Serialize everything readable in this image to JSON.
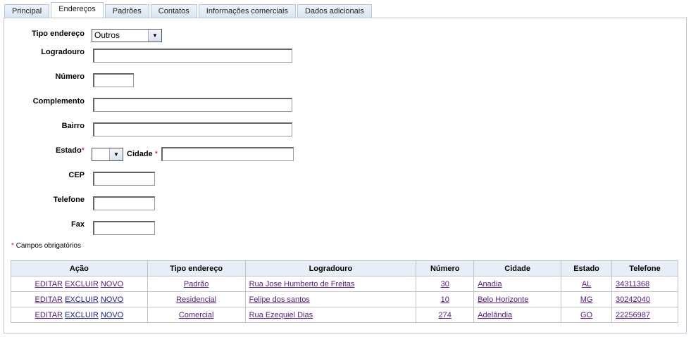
{
  "tabs": [
    "Principal",
    "Endereços",
    "Padrões",
    "Contatos",
    "Informações comerciais",
    "Dados adicionais"
  ],
  "form": {
    "tipo_label": "Tipo endereço",
    "tipo_value": "Outros",
    "logradouro_label": "Logradouro",
    "numero_label": "Número",
    "complemento_label": "Complemento",
    "bairro_label": "Bairro",
    "estado_label": "Estado",
    "cidade_label": "Cidade",
    "cep_label": "CEP",
    "telefone_label": "Telefone",
    "fax_label": "Fax",
    "required_mark": "*",
    "required_note": "Campos obrigatórios"
  },
  "table": {
    "headers": [
      "Ação",
      "Tipo endereço",
      "Logradouro",
      "Número",
      "Cidade",
      "Estado",
      "Telefone"
    ],
    "actions": [
      "EDITAR",
      "EXCLUIR",
      "NOVO"
    ],
    "rows": [
      {
        "tipo": "Padrão",
        "logradouro": "Rua Jose Humberto de Freitas",
        "numero": "30",
        "cidade": "Anadia",
        "estado": "AL",
        "telefone": "34311368"
      },
      {
        "tipo": "Residencial",
        "logradouro": "Felipe dos santos",
        "numero": "10",
        "cidade": "Belo Horizonte",
        "estado": "MG",
        "telefone": "30242040"
      },
      {
        "tipo": "Comercial",
        "logradouro": "Rua Ezequiel Dias",
        "numero": "274",
        "cidade": "Adelândia",
        "estado": "GO",
        "telefone": "22256987"
      }
    ]
  },
  "colors": {
    "link_visited": "#551a8b",
    "link": "#1a1aa6",
    "required": "#cc0000"
  }
}
